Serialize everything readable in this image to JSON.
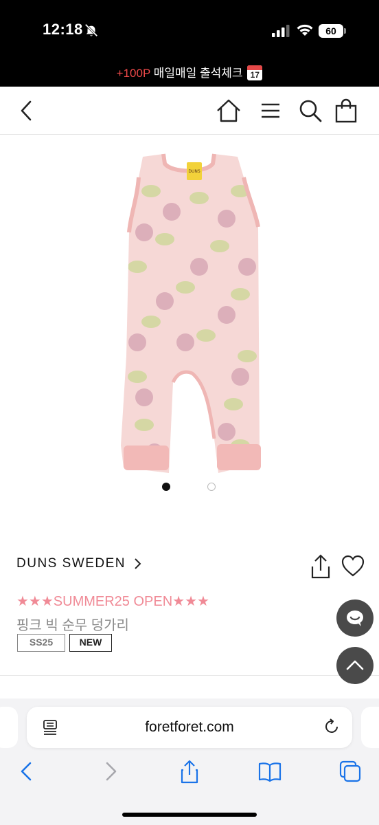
{
  "status_bar": {
    "time": "12:18",
    "battery": "60",
    "icons": [
      "bell-off-icon",
      "cellular-signal-icon",
      "wifi-icon",
      "battery-icon"
    ]
  },
  "promo_banner": {
    "points": "+100P",
    "text": "매일매일 출석체크",
    "calendar_month": "JUL",
    "calendar_day": "17",
    "accent_color": "#f04a4a"
  },
  "header": {
    "icons": [
      "back-chevron-icon",
      "home-icon",
      "menu-icon",
      "search-icon",
      "shopping-bag-icon"
    ]
  },
  "gallery": {
    "image_name": "pink dungarees with radish print",
    "slide_count": 2,
    "active_slide": 1
  },
  "product": {
    "brand": "DUNS SWEDEN",
    "promo_title": "★★★SUMMER25 OPEN★★★",
    "promo_color": "#f08a96",
    "name": "핑크 빅 순무 덩가리",
    "tags": [
      "SS25",
      "NEW"
    ]
  },
  "floating_buttons": {
    "icons": [
      "chat-icon",
      "scroll-top-icon"
    ]
  },
  "browser": {
    "url": "foretforet.com",
    "icons": [
      "reader-icon",
      "reload-icon",
      "back-icon",
      "forward-icon",
      "share-icon",
      "bookmarks-icon",
      "tabs-icon"
    ]
  }
}
